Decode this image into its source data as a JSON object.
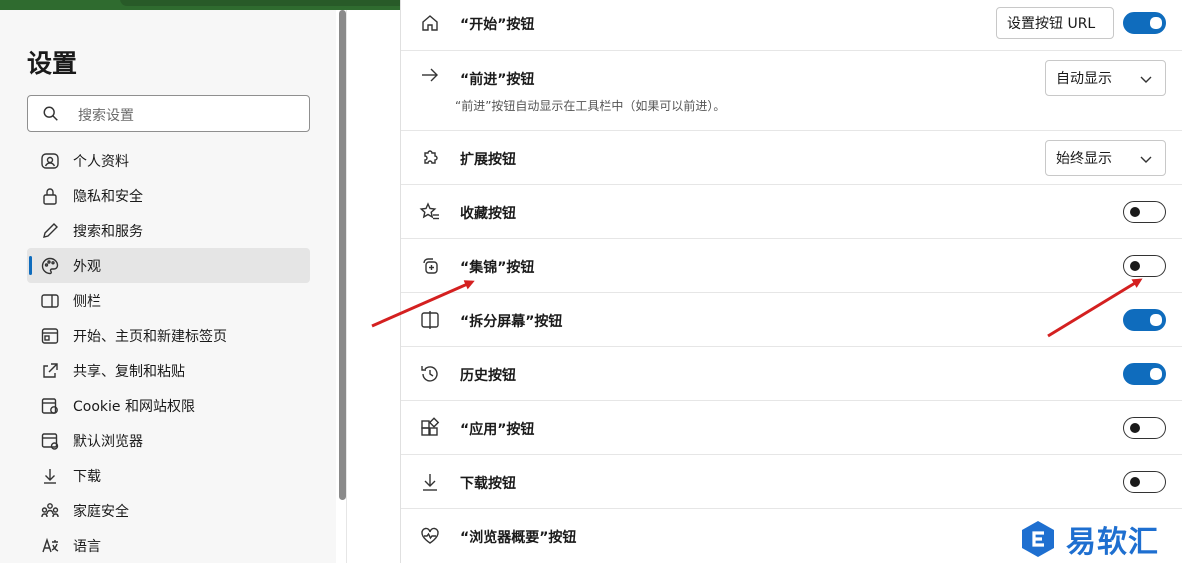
{
  "sidebar": {
    "title": "设置",
    "search_placeholder": "搜索设置",
    "items": [
      {
        "label": "个人资料",
        "icon": "profile-icon"
      },
      {
        "label": "隐私和安全",
        "icon": "lock-icon"
      },
      {
        "label": "搜索和服务",
        "icon": "pencil-icon"
      },
      {
        "label": "外观",
        "icon": "palette-icon",
        "active": true
      },
      {
        "label": "侧栏",
        "icon": "sidebar-icon"
      },
      {
        "label": "开始、主页和新建标签页",
        "icon": "home-tab-icon"
      },
      {
        "label": "共享、复制和粘贴",
        "icon": "share-icon"
      },
      {
        "label": "Cookie 和网站权限",
        "icon": "cookie-icon"
      },
      {
        "label": "默认浏览器",
        "icon": "browser-icon"
      },
      {
        "label": "下载",
        "icon": "download-icon"
      },
      {
        "label": "家庭安全",
        "icon": "family-icon"
      },
      {
        "label": "语言",
        "icon": "language-icon"
      }
    ]
  },
  "settings": {
    "home": {
      "label": "“开始”按钮",
      "button": "设置按钮 URL",
      "on": true
    },
    "forward": {
      "label": "“前进”按钮",
      "desc": "“前进”按钮自动显示在工具栏中（如果可以前进）。",
      "select": "自动显示"
    },
    "extensions": {
      "label": "扩展按钮",
      "select": "始终显示"
    },
    "favorites": {
      "label": "收藏按钮",
      "on": false
    },
    "collections": {
      "label": "“集锦”按钮",
      "on": false
    },
    "split": {
      "label": "“拆分屏幕”按钮",
      "on": true
    },
    "history": {
      "label": "历史按钮",
      "on": true
    },
    "apps": {
      "label": "“应用”按钮",
      "on": false
    },
    "downloads": {
      "label": "下载按钮",
      "on": false
    },
    "essentials": {
      "label": "“浏览器概要”按钮"
    }
  },
  "watermark": {
    "text": "易软汇"
  },
  "colors": {
    "accent": "#0f6cbd",
    "arrow": "#d42020",
    "watermark": "#1e6fd0"
  }
}
